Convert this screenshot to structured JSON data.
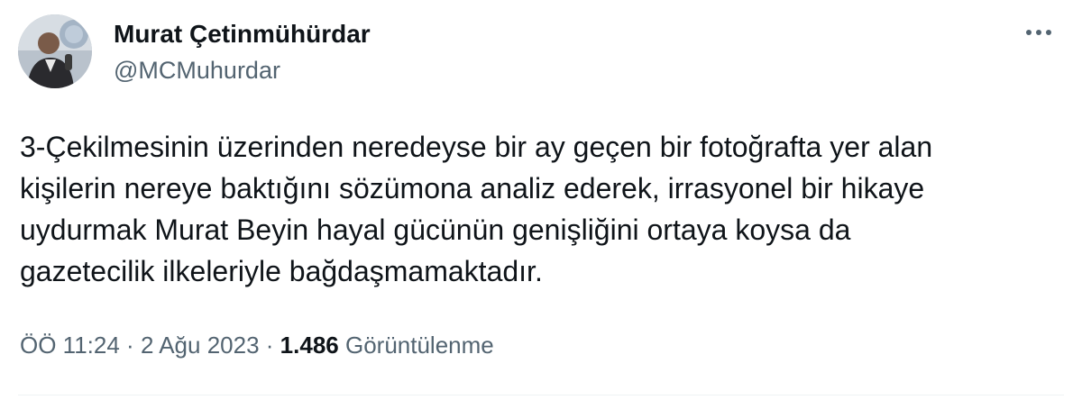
{
  "author": {
    "name": "Murat Çetinmühürdar",
    "handle": "@MCMuhurdar"
  },
  "tweet": {
    "text": "3-Çekilmesinin üzerinden neredeyse bir ay geçen bir fotoğrafta yer alan\nkişilerin nereye baktığını sözümona analiz ederek, irrasyonel bir hikaye\nuydurmak Murat Beyin hayal gücünün genişliğini ortaya koysa da\ngazetecilik ilkeleriyle bağdaşmamaktadır.",
    "time": "ÖÖ 11:24",
    "separator": "·",
    "date": "2 Ağu 2023",
    "views_count": "1.486",
    "views_label": "Görüntülenme"
  },
  "icons": {
    "more": "more-horizontal-icon"
  },
  "colors": {
    "text_primary": "#0f1419",
    "text_secondary": "#536471",
    "divider": "#eff3f4"
  }
}
